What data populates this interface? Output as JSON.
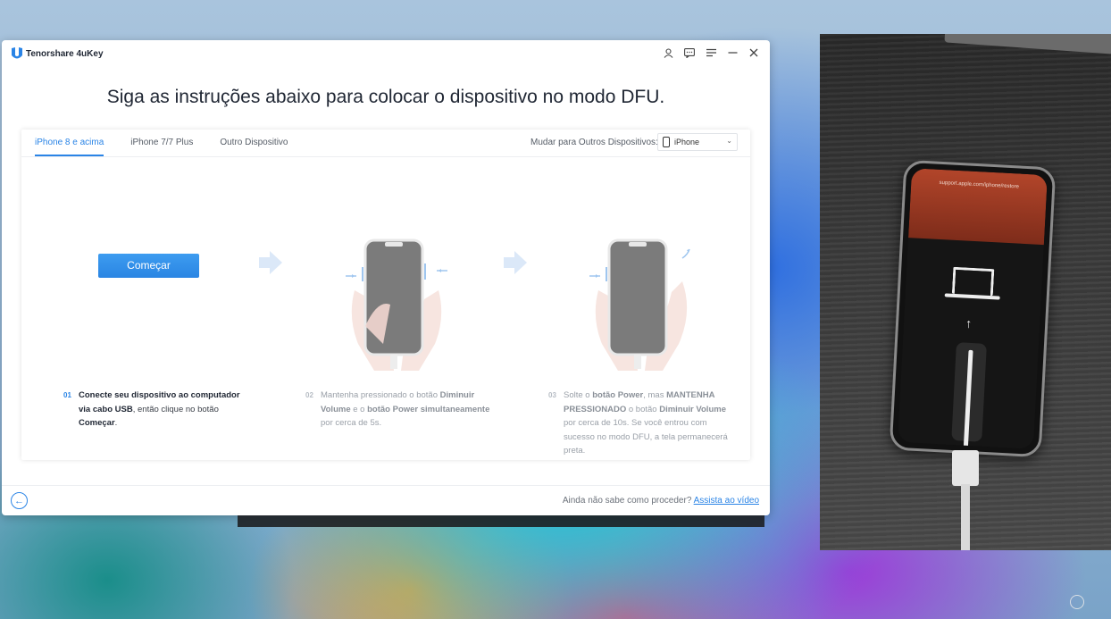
{
  "app": {
    "title": "Tenorshare 4uKey",
    "controls": [
      "user-icon",
      "chat-icon",
      "menu-icon",
      "minimize-icon",
      "close-icon"
    ]
  },
  "headline": "Siga as instruções abaixo para colocar o dispositivo no modo DFU.",
  "tabs": [
    {
      "label": "iPhone 8 e acima",
      "active": true
    },
    {
      "label": "iPhone 7/7 Plus",
      "active": false
    },
    {
      "label": "Outro Dispositivo",
      "active": false
    }
  ],
  "device_switch": {
    "label": "Mudar para Outros Dispositivos:",
    "selected": "iPhone"
  },
  "start_button": "Começar",
  "steps": [
    {
      "num": "01",
      "parts": [
        {
          "t": "Conecte seu dispositivo ao computador via cabo USB",
          "b": true
        },
        {
          "t": ", então clique no botão ",
          "b": false
        },
        {
          "t": "Começar",
          "b": true
        },
        {
          "t": ".",
          "b": false
        }
      ]
    },
    {
      "num": "02",
      "parts": [
        {
          "t": "Mantenha pressionado o botão ",
          "b": false
        },
        {
          "t": "Diminuir Volume",
          "b": true
        },
        {
          "t": " e o ",
          "b": false
        },
        {
          "t": "botão Power simultaneamente",
          "b": true
        },
        {
          "t": " por cerca de 5s.",
          "b": false
        }
      ]
    },
    {
      "num": "03",
      "parts": [
        {
          "t": "Solte o ",
          "b": false
        },
        {
          "t": "botão Power",
          "b": true
        },
        {
          "t": ", mas ",
          "b": false
        },
        {
          "t": "MANTENHA PRESSIONADO",
          "b": true
        },
        {
          "t": " o botão ",
          "b": false
        },
        {
          "t": "Diminuir Volume",
          "b": true
        },
        {
          "t": " por cerca de 10s. Se você entrou com sucesso no modo DFU, a tela permanecerá preta.",
          "b": false
        }
      ]
    }
  ],
  "footer": {
    "help_text": "Ainda não sabe como proceder?",
    "help_link": "Assista ao vídeo"
  },
  "camera_feed": {
    "screen_url": "support.apple.com/iphone/restore"
  },
  "colors": {
    "accent": "#2a84e6",
    "text": "#1f2633"
  }
}
